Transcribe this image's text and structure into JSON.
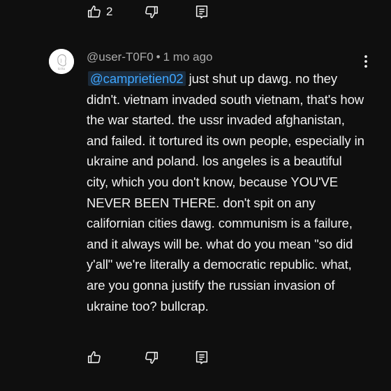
{
  "top_actions": {
    "like_count": "2"
  },
  "comment": {
    "author": "@user-T0F0",
    "separator": "•",
    "time": "1 mo ago",
    "mention": "@camprietien02",
    "text": " just shut up dawg. no they didn't. vietnam invaded south vietnam, that's how the war started. the ussr invaded afghanistan, and failed. it tortured its own people, especially in ukraine and poland. los angeles is a beautiful city, which you don't know, because YOU'VE NEVER BEEN THERE. don't spit on any californian cities dawg. communism is a failure, and it always will be. what do you mean \"so did y'all\" we're literally a democratic republic. what, are you gonna justify the russian invasion of ukraine too? bullcrap."
  },
  "icons": {
    "like": "thumbs-up-icon",
    "dislike": "thumbs-down-icon",
    "reply": "reply-icon",
    "more": "more-vertical-icon"
  },
  "colors": {
    "background": "#0f0f0f",
    "text": "#f1f1f1",
    "secondary_text": "#aaaaaa",
    "mention": "#3ea6ff",
    "mention_bg": "#1b2a3a"
  }
}
